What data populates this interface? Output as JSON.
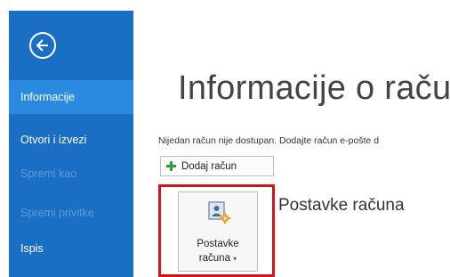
{
  "sidebar": {
    "items": [
      {
        "label": "Informacije",
        "state": "active"
      },
      {
        "label": "Otvori i izvezi",
        "state": "normal"
      },
      {
        "label": "Spremi kao",
        "state": "disabled"
      },
      {
        "label": "Spremi privitke",
        "state": "disabled"
      },
      {
        "label": "Ispis",
        "state": "normal"
      }
    ],
    "bg_color": "#1a6fc4",
    "active_color": "#2a8ae0"
  },
  "main": {
    "title": "Informacije o raču",
    "info_text": "Nijedan račun nije dostupan. Dodajte račun e-pošte d",
    "add_button_label": "Dodaj račun",
    "settings_tile": {
      "line1": "Postavke",
      "line2": "računa",
      "caret": "▾"
    },
    "section_title": "Postavke računa"
  },
  "icons": {
    "back": "arrow-left-circle-icon",
    "add": "plus-icon",
    "account_settings": "account-gear-icon"
  },
  "highlight_color": "#d0141c"
}
